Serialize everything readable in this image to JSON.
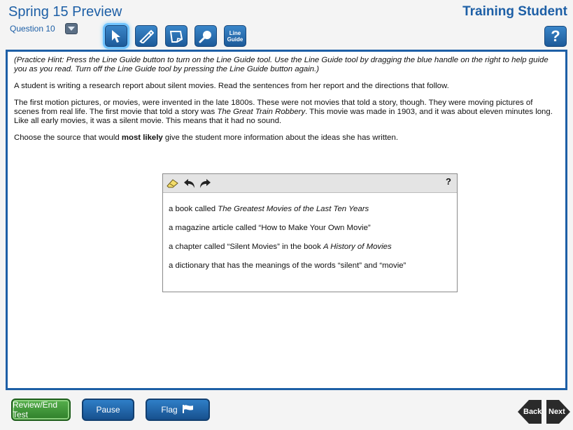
{
  "header": {
    "test_title": "Spring 15 Preview",
    "question_label": "Question 10",
    "student_name": "Training Student",
    "help_label": "?"
  },
  "toolbar": {
    "tools": [
      {
        "name": "pointer",
        "icon": "pointer-arrow-icon"
      },
      {
        "name": "highlighter",
        "icon": "highlighter-icon"
      },
      {
        "name": "sticky-note",
        "icon": "note-icon"
      },
      {
        "name": "magnifier",
        "icon": "magnifier-icon"
      },
      {
        "name": "line-guide",
        "label_line1": "Line",
        "label_line2": "Guide"
      }
    ]
  },
  "passage": {
    "hint": "(Practice Hint: Press the Line Guide button to turn on the Line Guide tool. Use the Line Guide tool by dragging the blue handle on the right to help guide you as you read. Turn off the Line Guide tool by pressing the Line Guide button again.)",
    "intro": "A student is writing a research report about silent movies. Read the sentences from her report and the directions that follow.",
    "excerpt_part1": "The first motion pictures, or movies, were invented in the late 1800s. These were not movies that told a story, though. They were moving pictures of scenes from real life. The first movie that told a story was ",
    "excerpt_title": "The Great Train Robbery",
    "excerpt_part2": ". This movie was made in 1903, and it was about eleven minutes long. Like all early movies, it was a silent movie. This means that it had no sound.",
    "directions_part1": "Choose the source that would ",
    "directions_bold": "most likely",
    "directions_part2": " give the student more information about the ideas she has written."
  },
  "answer_box": {
    "help_label": "?",
    "choices": [
      {
        "lead": "a book called ",
        "italic": "The Greatest Movies of the Last Ten Years",
        "tail": ""
      },
      {
        "lead": "a magazine article called “How to Make Your Own Movie”",
        "italic": "",
        "tail": ""
      },
      {
        "lead": "a chapter called “Silent Movies” in the book ",
        "italic": "A History of Movies",
        "tail": ""
      },
      {
        "lead": "a dictionary that has the meanings of the words “silent” and “movie”",
        "italic": "",
        "tail": ""
      }
    ]
  },
  "footer": {
    "review_label": "Review/End Test",
    "pause_label": "Pause",
    "flag_label": "Flag",
    "back_label": "Back",
    "next_label": "Next"
  },
  "colors": {
    "brand_blue": "#1d5fa6",
    "active_glow": "#6fc3ff",
    "review_green": "#3f9a38"
  }
}
